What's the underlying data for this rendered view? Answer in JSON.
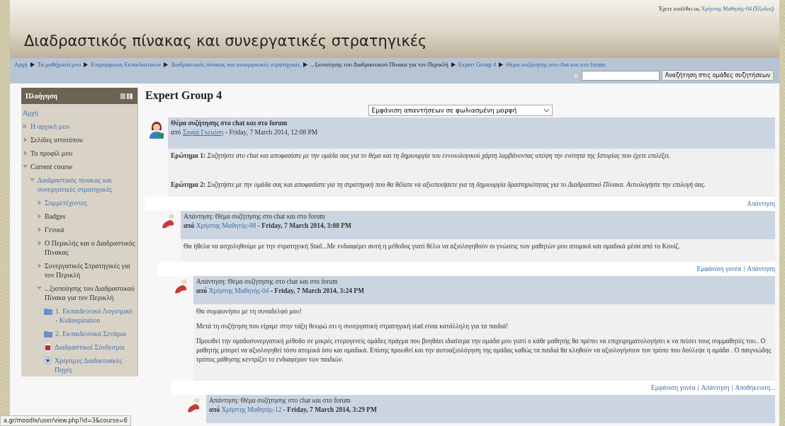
{
  "header": {
    "title": "Διαδραστικός πίνακας και συνεργατικές στρατηγικές",
    "login": {
      "prefix": "Έχετε εισέλθει ως",
      "user": "Χρήστης Μαθητής-04",
      "logout_open": "(",
      "logout": "Έξοδος",
      "logout_close": ")"
    }
  },
  "breadcrumb": [
    {
      "label": "Αρχή",
      "link": true
    },
    {
      "label": "Τα μαθήματά μου",
      "link": true
    },
    {
      "label": "Επιμόρφωση Εκπαιδευτικών",
      "link": true
    },
    {
      "label": "Διαδραστικός πίνακας και συνεργατικές στρατηγικές",
      "link": true
    },
    {
      "label": "...ξιοποίησης του Διαδραστικού Πίνακα για τον Περικλή",
      "link": false
    },
    {
      "label": "Expert Group 4",
      "link": true
    },
    {
      "label": "Θέμα συζήτησης στο chat και στο forum",
      "link": true
    }
  ],
  "search": {
    "button": "Αναζήτηση στις ομάδες συζητήσεων"
  },
  "sidebar": {
    "title": "Πλοήγηση",
    "items": [
      {
        "label": "Αρχή",
        "kind": "plain",
        "link": true
      },
      {
        "label": "Η αρχική μου",
        "kind": "bullet",
        "link": true
      },
      {
        "label": "Σελίδες ιστοτόπου",
        "kind": "branch",
        "expanded": false,
        "link": false
      },
      {
        "label": "Το προφίλ μου",
        "kind": "branch",
        "expanded": false,
        "link": false
      },
      {
        "label": "Current course",
        "kind": "branch",
        "expanded": true,
        "link": false,
        "children": [
          {
            "label": "Διαδραστικός πίνακας και συνεργατικές στρατηγικές",
            "kind": "branch",
            "expanded": true,
            "link": true,
            "children": [
              {
                "label": "Συμμετέχοντες",
                "kind": "branch",
                "expanded": false,
                "link": true
              },
              {
                "label": "Badges",
                "kind": "branch",
                "expanded": false,
                "link": false
              },
              {
                "label": "Γενικά",
                "kind": "branch",
                "expanded": false,
                "link": false
              },
              {
                "label": "Ο Περικλής και ο Διαδραστικός Πίνακας",
                "kind": "branch",
                "expanded": false,
                "link": false
              },
              {
                "label": "Συνεργατικές Στρατηγικές για τον Περικλή",
                "kind": "branch",
                "expanded": false,
                "link": false
              },
              {
                "label": "...ξιοποίησης του Διαδραστικού Πίνακα για τον Περικλή",
                "kind": "branch",
                "expanded": true,
                "link": false,
                "children": [
                  {
                    "label": "1. Εκπαιδευτικό Λογισμικό - Kidinspiration",
                    "kind": "folder",
                    "link": true
                  },
                  {
                    "label": "2. Εκπαιδευτικά Σενάρια",
                    "kind": "folder",
                    "link": true
                  },
                  {
                    "label": "Διαδραστικοί Σύνδεσμοι",
                    "kind": "file",
                    "link": true
                  },
                  {
                    "label": "Χρήσιμες Διαδικτυακές Πηγές",
                    "kind": "url",
                    "link": true
                  }
                ]
              }
            ]
          }
        ]
      }
    ]
  },
  "main": {
    "heading": "Expert Group 4",
    "action_separator": "|",
    "display_mode": "Εμφάνιση απαντήσεων σε φωλιασμένη μορφή",
    "thread": [
      {
        "kind": "discussion",
        "subject": "Θέμα συζήτησης στο chat και στο forum",
        "by_label": "από",
        "author": "Σοφία Γκεμίση",
        "date": " - Friday, 7 March 2014, 12:08 PM",
        "body": [
          "**Ερώτημα 1:** *Συζητήστε στο chat και αποφασίστε με την ομάδα σας για το θέμα και τη δημιουργία του εννοιολογικού χάρτη λαμβάνοντας υπόψη την ενότητα της Ιστορίας που έχετε επιλέξει.*",
          "**Ερώτημα 2:** *Συζητήστε με την ομάδα σας και αποφασίστε για τη στρατηγική που θα θέλατε να αξιοποιήσετε για τη δημιουργία δραστηριότητας για το Διαδραστικό Πίνακα. Αιτιολογήστε την επιλογή σας.*"
        ],
        "actions": [
          "Απάντηση"
        ],
        "children": [
          {
            "kind": "reply",
            "subject": "Απάντηση: Θέμα συζήτησης στο chat και στο forum",
            "by_label": "από",
            "author": "Χρήστης Μαθητής-08",
            "date": " - Friday, 7 March 2014, 3:08 PM",
            "body": [
              "Θα ήθελα να ασχοληθούμε με την στρατηγική  Stad...Με  ενδιαφέρει αυτή η μέθοδος  γιατί  θέλω να αξιολογηθούν οι γνώσεις των μαθητών μου ατομικά και ομαδικά μέσα από το Κουίζ."
            ],
            "actions": [
              "Εμφάνιση γονέα",
              "Απάντηση"
            ],
            "children": [
              {
                "kind": "reply",
                "subject": "Απάντηση: Θέμα συζήτησης στο chat και στο forum",
                "by_label": "από",
                "author": "Χρήστης Μαθητής-04",
                "date": " - Friday, 7 March 2014, 3:24 PM",
                "body": [
                  "Θα συμφωνήσω με τη συναδελφό μου!",
                  "Μετά τη συζήτηση που είχαμε στην τάξη θεωρώ οτι η συνεργατική στρατηγική stad είναι κατάλληλη για τα παιδιά!",
                  " Προωθεί την ομαδοσυνεργατική μέθοδο   σε μικρές ετερογενείς ομάδες πράγμα που  βοηθάει ιδιαίτερα την ομάδα μου  γιατί ο κάθε μαθητής θα πρέπει να επιχειρηματολογήσει κ να πείσει τους συμμαθητές του.. Ο  μαθητής μπορεί να αξιολογηθεί τόσο ατομικά όσο και ομαδικά. Επίσης προωθεί και την αυτοαξιολόγηση της ομάδας καθώς τα παιδιά θα κληθούν  να αξιολογήσουν τον τρόπο που δούλεψε η ομάδα . Ο παιγνιώδης τρόπος μάθησης κεντρίζει  το ενδιαφέρον των παιδιών."
                ],
                "actions": [
                  "Εμφάνιση γονέα",
                  "Απάντηση",
                  "Αποθήκευση..."
                ],
                "children": [
                  {
                    "kind": "reply",
                    "subject": "Απάντηση: Θέμα συζήτησης στο chat και στο forum",
                    "by_label": "από",
                    "author": "Χρήστης Μαθητής-12",
                    "date": " - Friday, 7 March 2014, 3:29 PM"
                  }
                ]
              }
            ]
          }
        ]
      }
    ]
  },
  "status_url": "a.gr/moodle/user/view.php?id=3&course=6"
}
